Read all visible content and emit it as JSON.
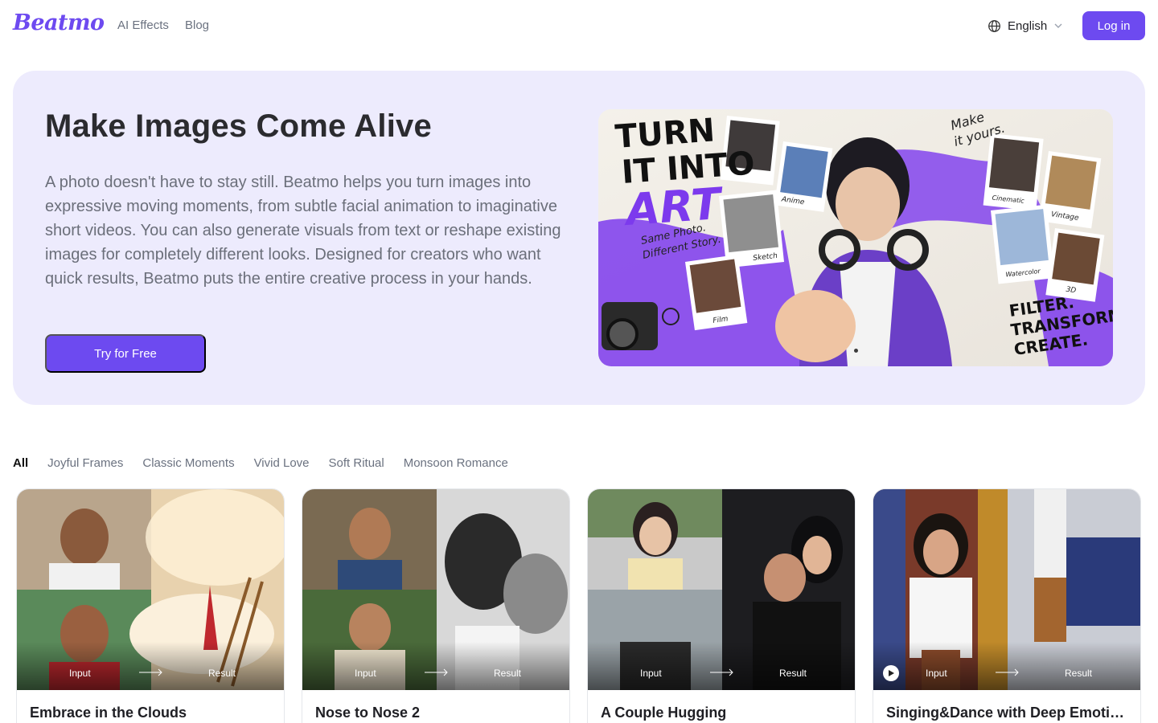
{
  "header": {
    "logo": "Beatmo",
    "nav": [
      "AI Effects",
      "Blog"
    ],
    "language": "English",
    "login_label": "Log in"
  },
  "hero": {
    "title": "Make Images Come Alive",
    "description": "A photo doesn't have to stay still. Beatmo helps you turn images into expressive moving moments, from subtle facial animation to imaginative short videos. You can also generate visuals from text or reshape existing images for completely different looks. Designed for creators who want quick results, Beatmo puts the entire creative process in your hands.",
    "cta_label": "Try for Free",
    "banner": {
      "headline_1": "TURN",
      "headline_2": "IT INTO",
      "headline_3": "ART",
      "subline_1": "Same Photo.",
      "subline_2": "Different Story.",
      "corner_note_1": "Make",
      "corner_note_2": "it yours.",
      "tagline_1": "FILTER.",
      "tagline_2": "TRANSFORM.",
      "tagline_3": "CREATE.",
      "styles": [
        "Anime",
        "Sketch",
        "Film",
        "Cinematic",
        "Vintage",
        "Watercolor",
        "3D"
      ]
    }
  },
  "filters": {
    "active_index": 0,
    "items": [
      "All",
      "Joyful Frames",
      "Classic Moments",
      "Vivid Love",
      "Soft Ritual",
      "Monsoon Romance"
    ]
  },
  "cards": [
    {
      "title": "Embrace in the Clouds",
      "input_label": "Input",
      "result_label": "Result"
    },
    {
      "title": "Nose to Nose 2",
      "input_label": "Input",
      "result_label": "Result"
    },
    {
      "title": "A Couple Hugging",
      "input_label": "Input",
      "result_label": "Result"
    },
    {
      "title": "Singing&Dance with Deep Emoti…",
      "input_label": "Input",
      "result_label": "Result"
    }
  ],
  "colors": {
    "brand": "#6d4af0",
    "hero_bg": "#edebfd",
    "muted_text": "#6b7280"
  }
}
